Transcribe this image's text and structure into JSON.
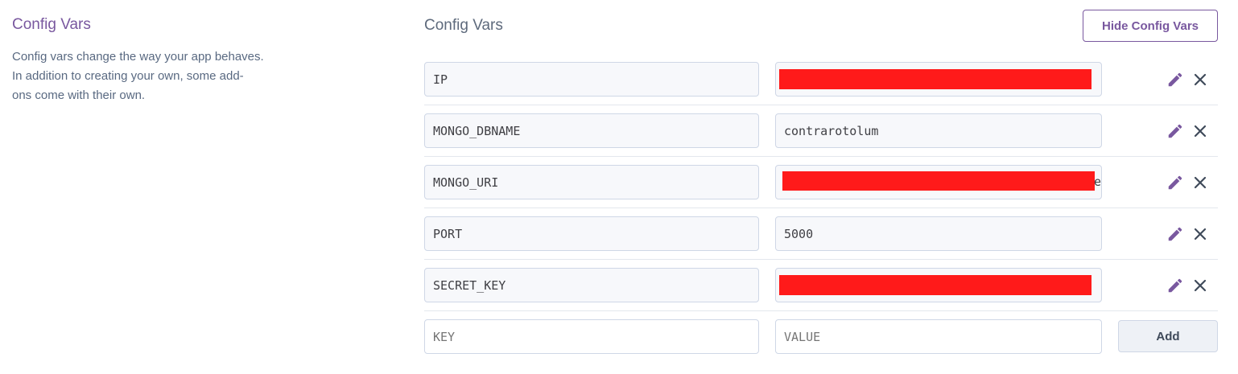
{
  "sidebar": {
    "title": "Config Vars",
    "description_lines": [
      "Config vars change the way your app behaves.",
      "In addition to creating your own, some add-",
      "ons come with their own."
    ]
  },
  "main": {
    "title": "Config Vars",
    "hide_button_label": "Hide Config Vars",
    "vars": [
      {
        "key": "IP",
        "value": "",
        "redacted": true
      },
      {
        "key": "MONGO_DBNAME",
        "value": "contrarotolum",
        "redacted": false
      },
      {
        "key": "MONGO_URI",
        "value": "e",
        "redacted": true
      },
      {
        "key": "PORT",
        "value": "5000",
        "redacted": false
      },
      {
        "key": "SECRET_KEY",
        "value": "",
        "redacted": true
      }
    ],
    "new_var": {
      "key_placeholder": "KEY",
      "value_placeholder": "VALUE",
      "add_button_label": "Add"
    }
  },
  "icons": {
    "edit": "pencil-icon",
    "delete": "close-icon"
  },
  "colors": {
    "accent": "#79589f",
    "redaction": "#ff1a1a",
    "text": "#3f3f44"
  }
}
